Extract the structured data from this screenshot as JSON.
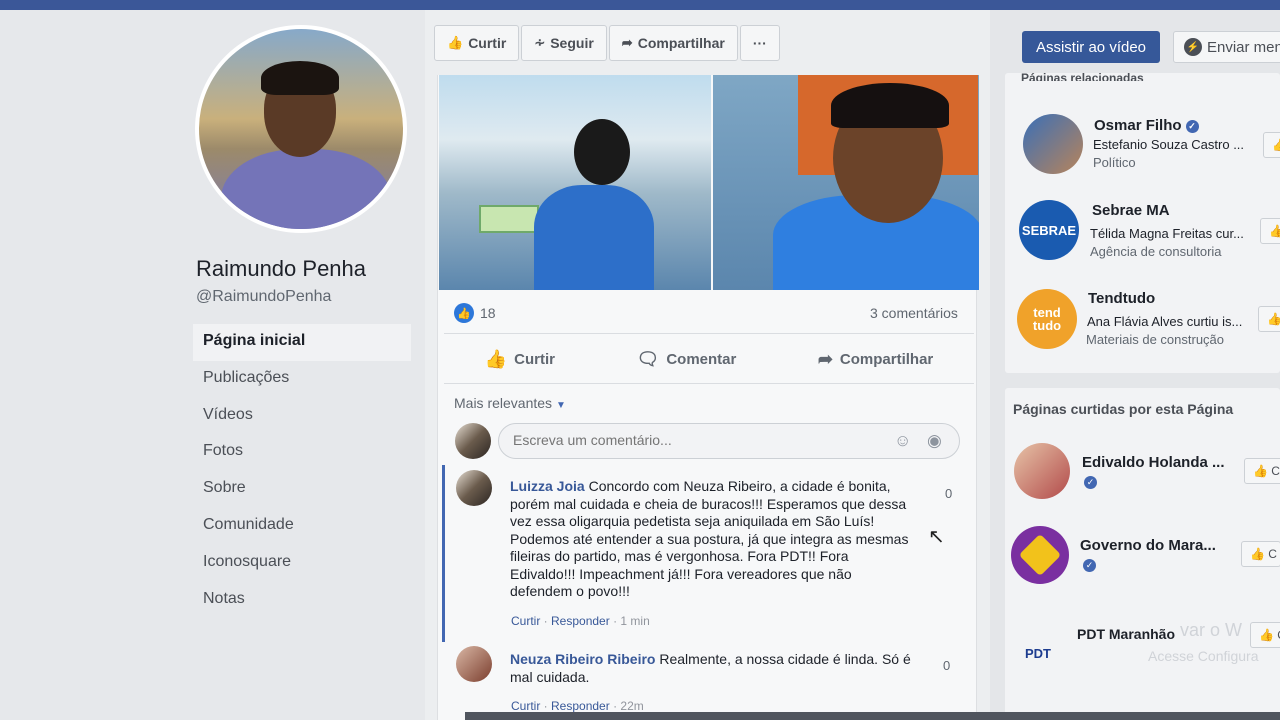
{
  "profile": {
    "name": "Raimundo Penha",
    "handle": "@RaimundoPenha"
  },
  "nav": {
    "items": [
      {
        "label": "Página inicial",
        "active": true
      },
      {
        "label": "Publicações"
      },
      {
        "label": "Vídeos"
      },
      {
        "label": "Fotos"
      },
      {
        "label": "Sobre"
      },
      {
        "label": "Comunidade"
      },
      {
        "label": "Iconosquare"
      },
      {
        "label": "Notas"
      }
    ]
  },
  "action_bar": {
    "like": "Curtir",
    "follow": "Seguir",
    "share": "Compartilhar",
    "more": "···"
  },
  "top_right": {
    "watch_video": "Assistir ao vídeo",
    "send_message": "Enviar men"
  },
  "post": {
    "like_count": "18",
    "comment_count": "3 comentários",
    "actions": {
      "like": "Curtir",
      "comment": "Comentar",
      "share": "Compartilhar"
    },
    "sort_label": "Mais relevantes",
    "comment_placeholder": "Escreva um comentário...",
    "comments": [
      {
        "author": "Luizza Joia",
        "text": "Concordo com Neuza Ribeiro, a cidade é bonita, porém mal cuidada e cheia de buracos!!! Esperamos que dessa vez essa oligarquia pedetista seja aniquilada em São Luís! Podemos até entender a sua postura, já que integra as mesmas fileiras do partido, mas é vergonhosa. Fora PDT!! Fora Edivaldo!!! Impeachment já!!! Fora vereadores que não defendem o povo!!!",
        "like_label": "Curtir",
        "reply_label": "Responder",
        "time": "1 min",
        "reactions": "0"
      },
      {
        "author": "Neuza Ribeiro Ribeiro",
        "text": "Realmente, a nossa cidade é linda. Só é mal cuidada.",
        "like_label": "Curtir",
        "reply_label": "Responder",
        "time": "22m",
        "reactions": "0"
      }
    ]
  },
  "related_pages": {
    "header": "Páginas relacionadas",
    "items": [
      {
        "name": "Osmar Filho",
        "sub": "Estefanio Souza Castro ...",
        "category": "Político",
        "verified": true
      },
      {
        "name": "Sebrae MA",
        "sub": "Télida Magna Freitas cur...",
        "category": "Agência de consultoria"
      },
      {
        "name": "Tendtudo",
        "sub": "Ana Flávia Alves curtiu is...",
        "category": "Materiais de construção",
        "logo_text": "tend tudo"
      }
    ]
  },
  "liked_pages": {
    "header": "Páginas curtidas por esta Página",
    "items": [
      {
        "name": "Edivaldo Holanda ...",
        "verified": true
      },
      {
        "name": "Governo do Mara...",
        "verified": true
      },
      {
        "name": "PDT Maranhão",
        "logo_text": "PDT"
      }
    ],
    "like_label": "C"
  },
  "watermark": {
    "line1": "var o W",
    "line2": "Acesse Configura"
  },
  "colors": {
    "brand": "#3b5798",
    "link": "#385898",
    "like_blue": "#2d77d9"
  }
}
